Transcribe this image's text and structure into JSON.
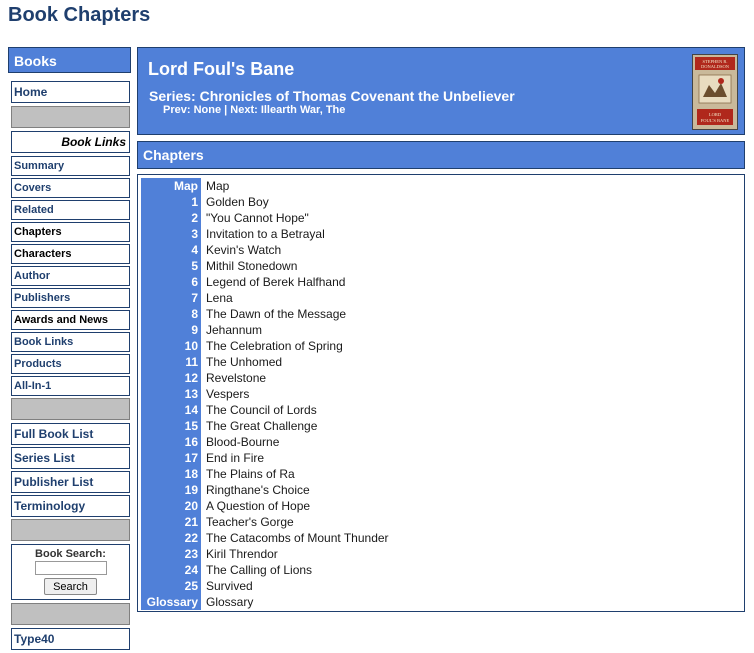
{
  "page": {
    "title": "Book Chapters"
  },
  "sidebar": {
    "header": "Books",
    "home": "Home",
    "book_links_title": "Book Links",
    "book_links": [
      "Summary",
      "Covers",
      "Related",
      "Chapters",
      "Characters",
      "Author",
      "Publishers",
      "Awards and News",
      "Book Links",
      "Products",
      "All-In-1"
    ],
    "lists": [
      "Full Book List",
      "Series List",
      "Publisher List",
      "Terminology"
    ],
    "search": {
      "label": "Book Search:",
      "placeholder": "",
      "button": "Search"
    },
    "footer_link": "Type40"
  },
  "book": {
    "title": "Lord Foul's Bane",
    "series": "Series: Chronicles of Thomas Covenant the Unbeliever",
    "nav": "Prev: None | Next: Illearth War, The",
    "cover": {
      "author": "STEPHEN R. DONALDSON",
      "title": "LORD FOUL'S BANE",
      "bg_color": "#c9b99a",
      "accent_color": "#b0281c"
    }
  },
  "chapters": {
    "header": "Chapters",
    "items": [
      {
        "num": "Map",
        "title": "Map"
      },
      {
        "num": "1",
        "title": "Golden Boy"
      },
      {
        "num": "2",
        "title": "\"You Cannot Hope\""
      },
      {
        "num": "3",
        "title": "Invitation to a Betrayal"
      },
      {
        "num": "4",
        "title": "Kevin's Watch"
      },
      {
        "num": "5",
        "title": "Mithil Stonedown"
      },
      {
        "num": "6",
        "title": "Legend of Berek Halfhand"
      },
      {
        "num": "7",
        "title": "Lena"
      },
      {
        "num": "8",
        "title": "The Dawn of the Message"
      },
      {
        "num": "9",
        "title": "Jehannum"
      },
      {
        "num": "10",
        "title": "The Celebration of Spring"
      },
      {
        "num": "11",
        "title": "The Unhomed"
      },
      {
        "num": "12",
        "title": "Revelstone"
      },
      {
        "num": "13",
        "title": "Vespers"
      },
      {
        "num": "14",
        "title": "The Council of Lords"
      },
      {
        "num": "15",
        "title": "The Great Challenge"
      },
      {
        "num": "16",
        "title": "Blood-Bourne"
      },
      {
        "num": "17",
        "title": "End in Fire"
      },
      {
        "num": "18",
        "title": "The Plains of Ra"
      },
      {
        "num": "19",
        "title": "Ringthane's Choice"
      },
      {
        "num": "20",
        "title": "A Question of Hope"
      },
      {
        "num": "21",
        "title": "Teacher's Gorge"
      },
      {
        "num": "22",
        "title": "The Catacombs of Mount Thunder"
      },
      {
        "num": "23",
        "title": "Kiril Threndor"
      },
      {
        "num": "24",
        "title": "The Calling of Lions"
      },
      {
        "num": "25",
        "title": "Survived"
      },
      {
        "num": "Glossary",
        "title": "Glossary"
      }
    ]
  },
  "colors": {
    "accent": "#5080d8",
    "dark": "#1f3f6e",
    "gray": "#c0c0c0"
  }
}
